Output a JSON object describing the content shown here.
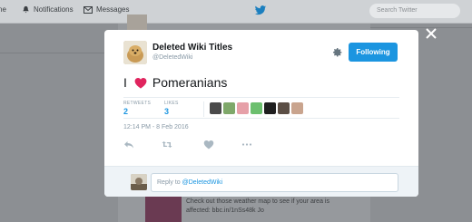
{
  "background": {
    "nav": {
      "home": "ne",
      "notifications": "Notifications",
      "messages": "Messages"
    },
    "search_placeholder": "Search Twitter",
    "tweet_snippet_line1": "Check out those weather map to see if your area is",
    "tweet_snippet_line2": "affected: bbc.in/1nSs48k Jo"
  },
  "modal": {
    "display_name": "Deleted Wiki Titles",
    "handle": "@DeletedWiki",
    "follow_label": "Following",
    "tweet": {
      "prefix": "I",
      "suffix": "Pomeranians"
    },
    "stats": {
      "retweets_label": "RETWEETS",
      "retweets_count": "2",
      "likes_label": "LIKES",
      "likes_count": "3"
    },
    "timestamp": "12:14 PM - 8 Feb 2016",
    "reply": {
      "prefix": "Reply to ",
      "mention": "@DeletedWiki"
    }
  },
  "colors": {
    "accent": "#1b95e0",
    "heart": "#e0245e",
    "overlay": "#8c8f93"
  }
}
